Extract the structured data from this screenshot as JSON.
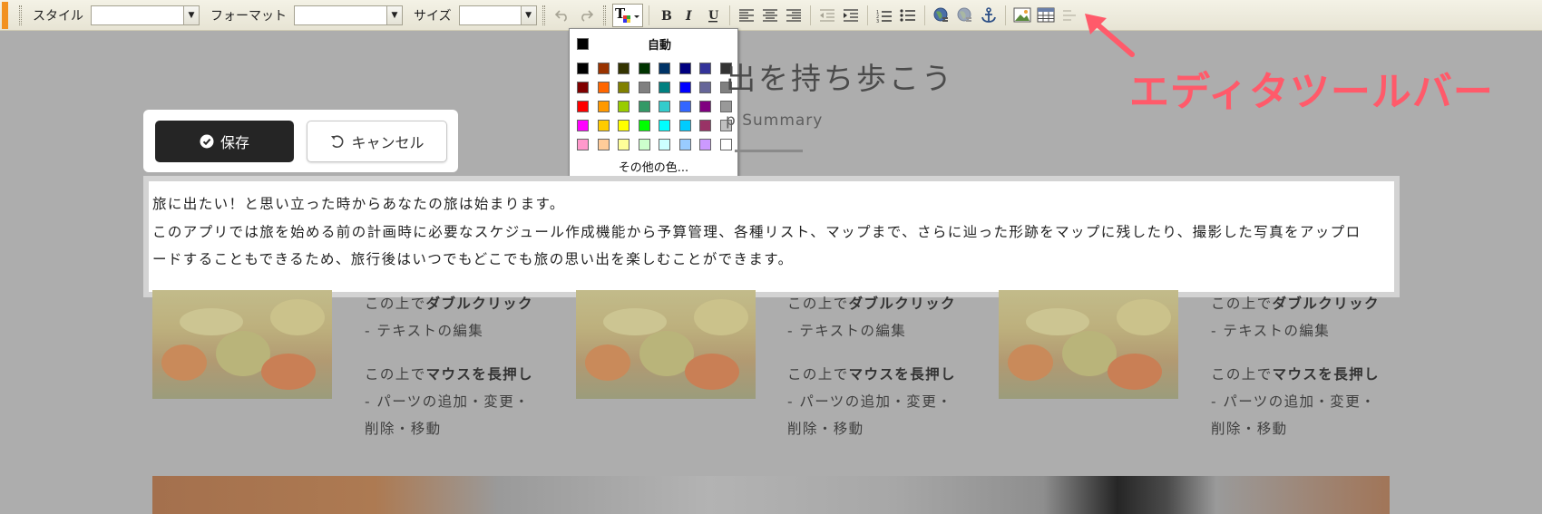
{
  "toolbar": {
    "style_label": "スタイル",
    "format_label": "フォーマット",
    "size_label": "サイズ",
    "accent_color": "#f2911f"
  },
  "color_dropdown": {
    "auto_label": "自動",
    "more_colors_label": "その他の色...",
    "swatches": [
      "#000000",
      "#993300",
      "#333300",
      "#003300",
      "#003366",
      "#000080",
      "#333399",
      "#333333",
      "#800000",
      "#ff6600",
      "#808000",
      "#808080",
      "#008080",
      "#0000ff",
      "#666699",
      "#808080",
      "#ff0000",
      "#ff9900",
      "#99cc00",
      "#339966",
      "#33cccc",
      "#3366ff",
      "#800080",
      "#999999",
      "#ff00ff",
      "#ffcc00",
      "#ffff00",
      "#00ff00",
      "#00ffff",
      "#00ccff",
      "#993366",
      "#c0c0c0",
      "#ff99cc",
      "#ffcc99",
      "#ffff99",
      "#ccffcc",
      "#ccffff",
      "#99ccff",
      "#cc99ff",
      "#ffffff"
    ]
  },
  "page": {
    "heading": "出を持ち歩こう",
    "subheading": "p Summary"
  },
  "actions": {
    "save_label": "保存",
    "cancel_label": "キャンセル"
  },
  "editor": {
    "lines": [
      "旅に出たい！と思い立った時からあなたの旅は始まります。",
      "このアプリでは旅を始める前の計画時に必要なスケジュール作成機能から予算管理、各種リスト、マップまで、さらに辿った形跡をマップに残したり、撮影した写真をアップロ",
      "ードすることもできるため、旅行後はいつでもどこでも旅の思い出を楽しむことができます。"
    ]
  },
  "feature": {
    "prefix": "この上で",
    "double_click": "ダブルクリック",
    "edit_text": "- テキストの編集",
    "long_press": "マウスを長押し",
    "parts_line1": "- パーツの追加・変更・",
    "parts_line2": "削除・移動"
  },
  "annotation": {
    "label": "エディタツールバー",
    "color": "#ff5a6a"
  }
}
